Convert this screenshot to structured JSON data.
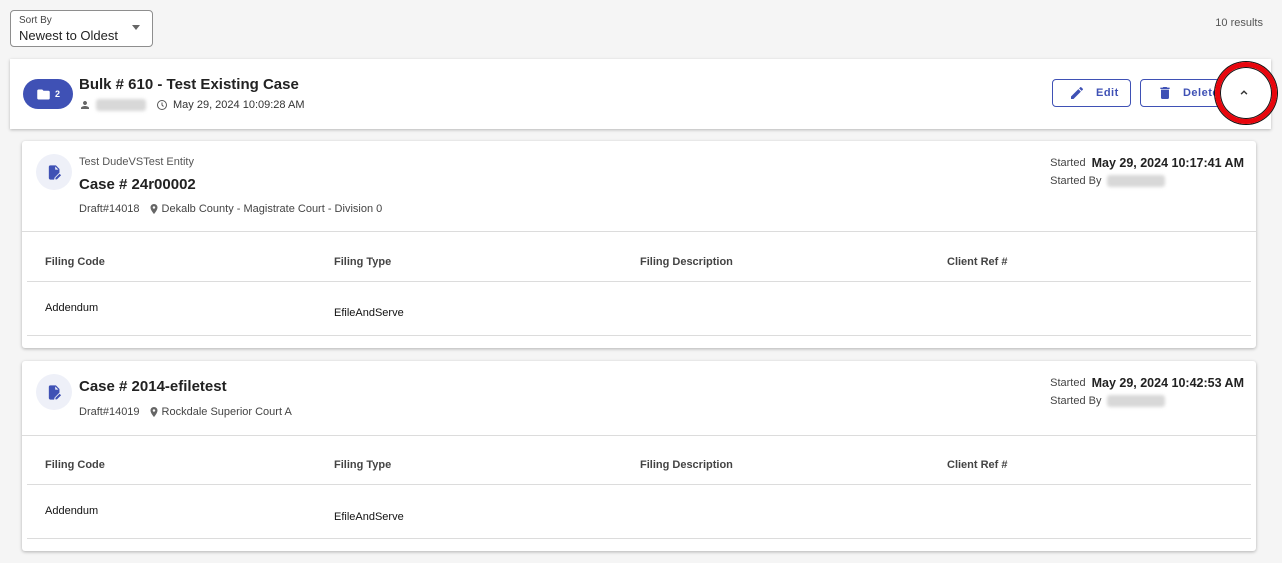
{
  "sort": {
    "label": "Sort By",
    "value": "Newest to Oldest"
  },
  "results_count": "10 results",
  "bulk": {
    "folder_count": "2",
    "title": "Bulk # 610 - Test Existing Case",
    "timestamp": "May 29, 2024 10:09:28 AM",
    "edit_label": "Edit",
    "delete_label": "Delete"
  },
  "table_headers": [
    "Filing Code",
    "Filing Type",
    "Filing Description",
    "Client Ref #"
  ],
  "cases": [
    {
      "entity": "Test DudeVSTest Entity",
      "title": "Case # 24r00002",
      "draft": "Draft#14018",
      "court": "Dekalb County - Magistrate Court - Division 0",
      "started_label": "Started",
      "started_date": "May 29, 2024 10:17:41 AM",
      "started_by_label": "Started By",
      "rows": [
        {
          "filing_code": "Addendum",
          "filing_type": "EfileAndServe",
          "filing_description": "",
          "client_ref": ""
        }
      ]
    },
    {
      "title": "Case # 2014-efiletest",
      "draft": "Draft#14019",
      "court": "Rockdale Superior Court A",
      "started_label": "Started",
      "started_date": "May 29, 2024 10:42:53 AM",
      "started_by_label": "Started By",
      "rows": [
        {
          "filing_code": "Addendum",
          "filing_type": "EfileAndServe",
          "filing_description": "",
          "client_ref": ""
        }
      ]
    }
  ],
  "colors": {
    "primary": "#3f51b5",
    "highlight": "#e8060d"
  },
  "icons": [
    "folder-icon",
    "person-icon",
    "clock-icon",
    "pencil-icon",
    "trash-icon",
    "chevron-up-icon",
    "edit-document-icon",
    "location-pin-icon"
  ]
}
